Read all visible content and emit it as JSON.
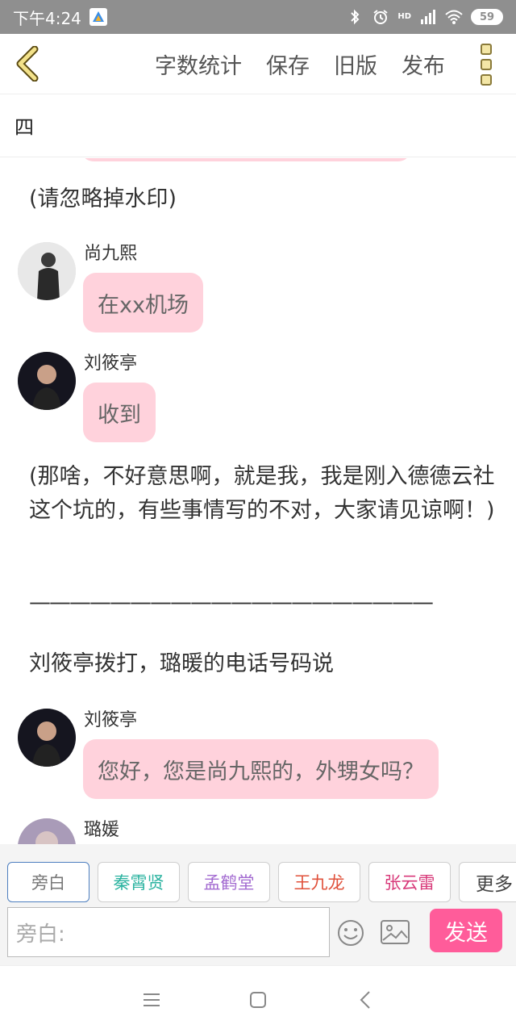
{
  "status_bar": {
    "time": "下午4:24",
    "battery": "59",
    "network": "HD"
  },
  "header": {
    "actions": [
      "字数统计",
      "保存",
      "旧版",
      "发布"
    ]
  },
  "chapter": {
    "title": "四"
  },
  "content": {
    "note_watermark": "(请忽略掉水印)",
    "messages": [
      {
        "sender": "尚九熙",
        "text": "在xx机场"
      },
      {
        "sender": "刘筱亭",
        "text": "收到"
      }
    ],
    "author_note": "(那啥，不好意思啊，就是我，我是刚入德德云社这个坑的，有些事情写的不对，大家请见谅啊！)",
    "divider": "————————————————————",
    "narration": "刘筱亭拨打，璐暖的电话号码说",
    "messages2": [
      {
        "sender": "刘筱亭",
        "text": "您好，您是尚九熙的，外甥女吗？"
      },
      {
        "sender": "璐媛",
        "text": ""
      }
    ]
  },
  "roles": [
    "旁白",
    "秦霄贤",
    "孟鹤堂",
    "王九龙",
    "张云雷",
    "更多"
  ],
  "role_colors": {
    "旁白": "#777777",
    "秦霄贤": "#2bb3a0",
    "孟鹤堂": "#a36bd1",
    "王九龙": "#e0503a",
    "张云雷": "#d83a7a",
    "更多": "#444444"
  },
  "composer": {
    "placeholder": "旁白:",
    "send_label": "发送"
  }
}
